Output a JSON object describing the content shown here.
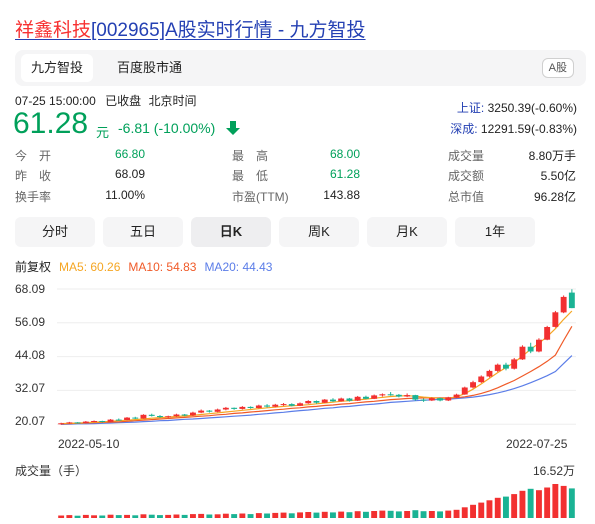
{
  "title": {
    "highlight": "祥鑫科技",
    "rest": "[002965]A股实时行情 - 九方智投"
  },
  "tabs": [
    {
      "label": "九方智投",
      "active": true
    },
    {
      "label": "百度股市通",
      "active": false
    }
  ],
  "market_badge": "A股",
  "status": {
    "datetime": "07-25 15:00:00",
    "state": "已收盘",
    "tz": "北京时间"
  },
  "quote": {
    "price": "61.28",
    "unit": "元",
    "change": "-6.81 (-10.00%)",
    "direction": "down",
    "color": "#00a05a"
  },
  "indices": [
    {
      "name": "上证:",
      "value": "3250.39(-0.60%)"
    },
    {
      "name": "深成:",
      "value": "12291.59(-0.83%)"
    }
  ],
  "stats": [
    {
      "label": "今　开",
      "value": "66.80",
      "tone": "green"
    },
    {
      "label": "最　高",
      "value": "68.00",
      "tone": "green"
    },
    {
      "label": "成交量",
      "value": "8.80万手",
      "tone": "dark"
    },
    {
      "label": "昨　收",
      "value": "68.09",
      "tone": "dark"
    },
    {
      "label": "最　低",
      "value": "61.28",
      "tone": "green"
    },
    {
      "label": "成交额",
      "value": "5.50亿",
      "tone": "dark"
    },
    {
      "label": "换手率",
      "value": "11.00%",
      "tone": "dark"
    },
    {
      "label": "市盈(TTM)",
      "value": "143.88",
      "tone": "dark"
    },
    {
      "label": "总市值",
      "value": "96.28亿",
      "tone": "dark"
    }
  ],
  "periods": [
    {
      "label": "分时",
      "active": false
    },
    {
      "label": "五日",
      "active": false
    },
    {
      "label": "日K",
      "active": true
    },
    {
      "label": "周K",
      "active": false
    },
    {
      "label": "月K",
      "active": false
    },
    {
      "label": "1年",
      "active": false
    }
  ],
  "legend": {
    "adjust": "前复权",
    "ma5": "MA5: 60.26",
    "ma10": "MA10: 54.83",
    "ma20": "MA20: 44.43"
  },
  "colors": {
    "up": "#f23030",
    "down": "#1ab394",
    "ma5": "#f5a623",
    "ma10": "#f05a28",
    "ma20": "#5b7de8"
  },
  "chart_data": {
    "type": "candlestick",
    "y_ticks": [
      "68.09",
      "56.09",
      "44.08",
      "32.07",
      "20.07"
    ],
    "ylim": [
      17.3,
      68.09
    ],
    "x_labels": [
      "2022-05-10",
      "2022-07-25"
    ],
    "volume_label": "成交量（手）",
    "volume_max_label": "16.52万",
    "volume_max": 16.52,
    "candles": [
      [
        20.1,
        20.6,
        19.9,
        20.4
      ],
      [
        20.4,
        20.9,
        20.2,
        20.7
      ],
      [
        20.7,
        20.8,
        20.3,
        20.5
      ],
      [
        20.5,
        21.2,
        20.4,
        21.0
      ],
      [
        21.0,
        21.4,
        20.8,
        21.2
      ],
      [
        21.2,
        21.3,
        20.7,
        20.9
      ],
      [
        20.9,
        21.9,
        20.8,
        21.7
      ],
      [
        21.7,
        22.1,
        21.3,
        21.5
      ],
      [
        21.5,
        22.6,
        21.4,
        22.4
      ],
      [
        22.4,
        22.7,
        21.9,
        22.1
      ],
      [
        22.1,
        23.6,
        22.0,
        23.4
      ],
      [
        23.4,
        23.8,
        22.8,
        23.0
      ],
      [
        23.0,
        23.3,
        22.3,
        22.6
      ],
      [
        22.6,
        23.1,
        22.2,
        22.9
      ],
      [
        22.9,
        23.8,
        22.7,
        23.5
      ],
      [
        23.5,
        23.7,
        22.9,
        23.2
      ],
      [
        23.2,
        24.5,
        23.0,
        24.2
      ],
      [
        24.2,
        25.3,
        24.0,
        24.9
      ],
      [
        24.9,
        25.1,
        24.2,
        24.5
      ],
      [
        24.5,
        25.6,
        24.3,
        25.3
      ],
      [
        25.3,
        26.2,
        25.0,
        25.9
      ],
      [
        25.9,
        26.0,
        25.2,
        25.5
      ],
      [
        25.5,
        26.5,
        25.3,
        26.2
      ],
      [
        26.2,
        26.4,
        25.6,
        25.8
      ],
      [
        25.8,
        27.0,
        25.7,
        26.7
      ],
      [
        26.7,
        27.2,
        26.0,
        26.3
      ],
      [
        26.3,
        27.3,
        26.1,
        27.0
      ],
      [
        27.0,
        27.6,
        26.6,
        27.2
      ],
      [
        27.2,
        27.5,
        26.4,
        26.6
      ],
      [
        26.6,
        27.8,
        26.5,
        27.5
      ],
      [
        27.5,
        28.6,
        27.3,
        28.3
      ],
      [
        28.3,
        28.5,
        27.4,
        27.7
      ],
      [
        27.7,
        29.0,
        27.6,
        28.8
      ],
      [
        28.8,
        29.3,
        28.0,
        28.2
      ],
      [
        28.2,
        29.5,
        28.1,
        29.2
      ],
      [
        29.2,
        29.4,
        28.1,
        28.4
      ],
      [
        28.4,
        30.1,
        28.3,
        29.8
      ],
      [
        29.8,
        30.2,
        28.9,
        29.1
      ],
      [
        29.1,
        30.6,
        29.0,
        30.3
      ],
      [
        30.3,
        31.0,
        29.9,
        30.7
      ],
      [
        30.7,
        31.5,
        30.2,
        30.5
      ],
      [
        30.5,
        30.8,
        29.6,
        29.9
      ],
      [
        29.9,
        31.0,
        29.7,
        30.4
      ],
      [
        30.4,
        30.5,
        28.4,
        28.8
      ],
      [
        28.8,
        29.2,
        28.0,
        28.5
      ],
      [
        28.5,
        29.6,
        28.3,
        29.3
      ],
      [
        29.3,
        29.5,
        28.2,
        28.5
      ],
      [
        28.5,
        29.8,
        28.3,
        29.6
      ],
      [
        29.6,
        30.9,
        29.4,
        30.6
      ],
      [
        30.6,
        33.4,
        30.5,
        33.1
      ],
      [
        33.1,
        35.5,
        32.8,
        35.0
      ],
      [
        35.0,
        37.4,
        34.7,
        37.0
      ],
      [
        37.0,
        39.4,
        36.7,
        39.0
      ],
      [
        39.0,
        41.6,
        38.6,
        41.2
      ],
      [
        41.2,
        41.9,
        39.2,
        39.8
      ],
      [
        39.8,
        43.6,
        39.5,
        43.1
      ],
      [
        43.1,
        48.1,
        42.9,
        47.6
      ],
      [
        47.6,
        49.0,
        45.3,
        45.9
      ],
      [
        45.9,
        50.6,
        45.6,
        50.1
      ],
      [
        50.1,
        55.0,
        49.9,
        54.6
      ],
      [
        54.6,
        60.3,
        54.4,
        59.8
      ],
      [
        59.8,
        65.8,
        59.5,
        65.3
      ],
      [
        66.8,
        68.0,
        61.28,
        61.28
      ]
    ],
    "volumes": [
      1.2,
      1.4,
      1.1,
      1.5,
      1.3,
      1.2,
      1.6,
      1.4,
      1.5,
      1.3,
      1.8,
      1.6,
      1.4,
      1.5,
      1.7,
      1.5,
      1.9,
      2.0,
      1.7,
      1.8,
      2.1,
      1.9,
      2.2,
      1.9,
      2.4,
      2.2,
      2.5,
      2.6,
      2.3,
      2.7,
      2.9,
      2.6,
      3.0,
      2.7,
      3.1,
      2.8,
      3.3,
      3.0,
      3.4,
      3.6,
      3.5,
      3.2,
      3.4,
      3.8,
      3.3,
      3.4,
      3.2,
      3.6,
      4.0,
      5.2,
      6.4,
      7.5,
      8.6,
      9.8,
      10.4,
      11.6,
      13.2,
      14.2,
      13.5,
      14.8,
      16.52,
      15.6,
      14.4
    ],
    "ma5": [
      20.3,
      20.4,
      20.5,
      20.6,
      20.8,
      20.9,
      21.1,
      21.3,
      21.5,
      21.7,
      21.9,
      22.2,
      22.4,
      22.6,
      22.8,
      23.0,
      23.2,
      23.5,
      23.8,
      24.1,
      24.4,
      24.7,
      25.0,
      25.3,
      25.6,
      25.9,
      26.1,
      26.4,
      26.6,
      26.8,
      27.0,
      27.3,
      27.6,
      27.9,
      28.2,
      28.4,
      28.7,
      29.0,
      29.3,
      29.6,
      29.9,
      30.1,
      30.2,
      30.0,
      29.7,
      29.5,
      29.2,
      29.3,
      29.8,
      30.9,
      32.5,
      34.4,
      36.4,
      38.4,
      40.2,
      42.0,
      44.3,
      46.7,
      48.8,
      51.2,
      54.0,
      57.3,
      60.26
    ],
    "ma10": [
      20.2,
      20.3,
      20.4,
      20.5,
      20.6,
      20.7,
      20.8,
      20.9,
      21.1,
      21.3,
      21.5,
      21.7,
      21.9,
      22.1,
      22.3,
      22.5,
      22.7,
      22.9,
      23.1,
      23.4,
      23.6,
      23.9,
      24.1,
      24.4,
      24.6,
      24.9,
      25.2,
      25.4,
      25.7,
      25.9,
      26.2,
      26.4,
      26.7,
      26.9,
      27.2,
      27.4,
      27.7,
      28.0,
      28.2,
      28.5,
      28.8,
      29.0,
      29.2,
      29.3,
      29.4,
      29.4,
      29.4,
      29.4,
      29.5,
      29.8,
      30.3,
      31.0,
      31.9,
      33.0,
      34.3,
      35.6,
      37.2,
      38.8,
      40.5,
      42.4,
      44.6,
      49.8,
      54.83
    ],
    "ma20": [
      20.0,
      20.1,
      20.2,
      20.2,
      20.3,
      20.4,
      20.5,
      20.6,
      20.7,
      20.8,
      21.0,
      21.1,
      21.3,
      21.4,
      21.6,
      21.8,
      21.9,
      22.1,
      22.3,
      22.5,
      22.7,
      22.9,
      23.1,
      23.3,
      23.6,
      23.8,
      24.1,
      24.3,
      24.6,
      24.9,
      25.1,
      25.4,
      25.7,
      25.9,
      26.2,
      26.4,
      26.7,
      27.0,
      27.2,
      27.5,
      27.8,
      28.0,
      28.2,
      28.4,
      28.6,
      28.7,
      28.9,
      29.0,
      29.2,
      29.4,
      29.7,
      30.1,
      30.6,
      31.2,
      31.9,
      32.7,
      33.7,
      34.8,
      36.0,
      37.3,
      38.8,
      41.6,
      44.43
    ]
  }
}
